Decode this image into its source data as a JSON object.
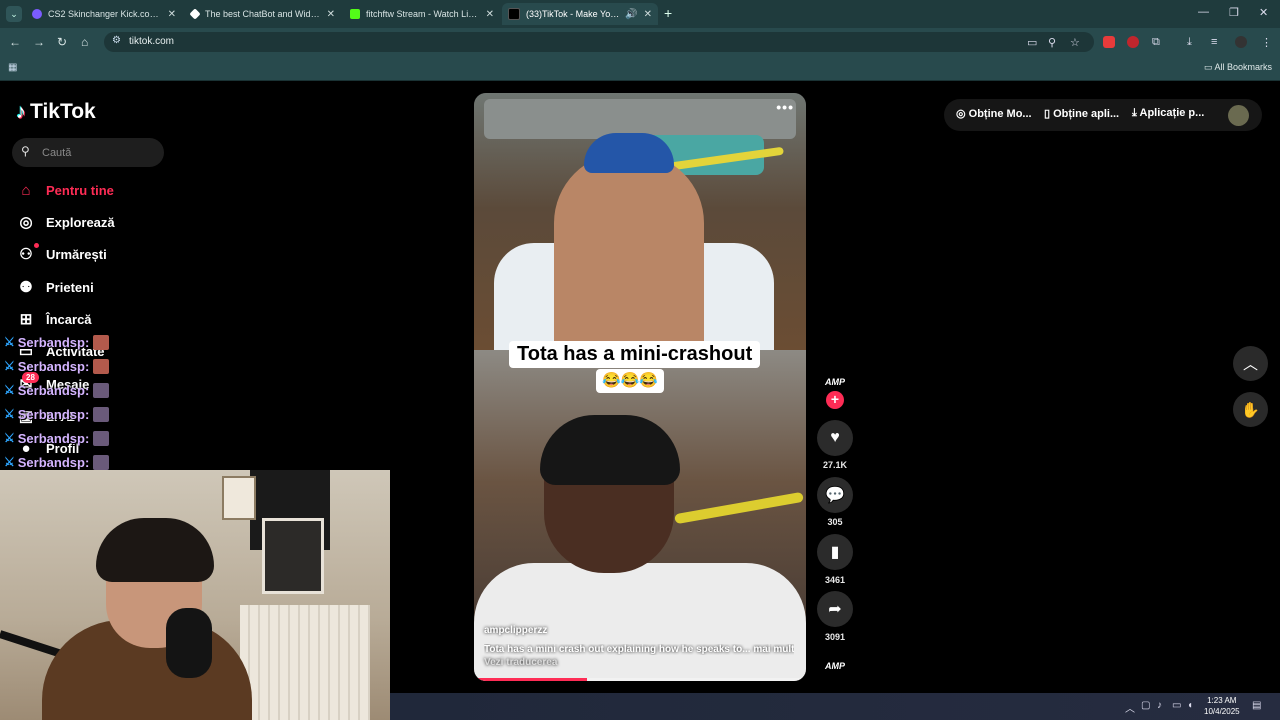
{
  "browser": {
    "tabs": [
      {
        "title": "CS2 Skinchanger Kick.com/stoo",
        "favicon_color": "#7b5cff"
      },
      {
        "title": "The best ChatBot and Widgets",
        "favicon_color": "#ffffff"
      },
      {
        "title": "fitchftw Stream - Watch Live on",
        "favicon_color": "#53fc18"
      },
      {
        "title": "(33)TikTok - Make Your Day",
        "favicon_color": "#000000"
      }
    ],
    "url": "tiktok.com",
    "bookmarks_label": "All Bookmarks"
  },
  "tiktok": {
    "logo_text": "TikTok",
    "search_placeholder": "Caută",
    "nav": [
      {
        "label": "Pentru tine",
        "icon": "home-icon"
      },
      {
        "label": "Explorează",
        "icon": "compass-icon"
      },
      {
        "label": "Urmărești",
        "icon": "following-icon"
      },
      {
        "label": "Prieteni",
        "icon": "friends-icon"
      },
      {
        "label": "Încarcă",
        "icon": "upload-icon"
      },
      {
        "label": "Activitate",
        "icon": "activity-icon"
      },
      {
        "label": "Mesaje",
        "icon": "messages-icon"
      },
      {
        "label": "LIVE",
        "icon": "live-icon"
      },
      {
        "label": "Profil",
        "icon": "profile-icon"
      }
    ],
    "messages_badge": "28",
    "top_buttons": [
      "Obține Mo...",
      "Obține apli...",
      "Aplicație p..."
    ],
    "video": {
      "caption": "Tota has a mini-crashout",
      "caption_emoji": "😂😂😂",
      "username": "ampclipperzz",
      "description": "Tota has a mini crash out explaining how he speaks to... mai mult",
      "translate": "Vezi traducerea",
      "progress": 0.34
    },
    "actions": {
      "creator_tag": "AMP",
      "likes": "27.1K",
      "comments": "305",
      "saves": "3461",
      "shares": "3091"
    }
  },
  "chat": {
    "lines": [
      "Serbandsp:",
      "Serbandsp:",
      "Serbandsp:",
      "Serbandsp:",
      "Serbandsp:",
      "Serbandsp:"
    ]
  },
  "taskbar": {
    "time": "1:23 AM",
    "date": "10/4/2025"
  }
}
